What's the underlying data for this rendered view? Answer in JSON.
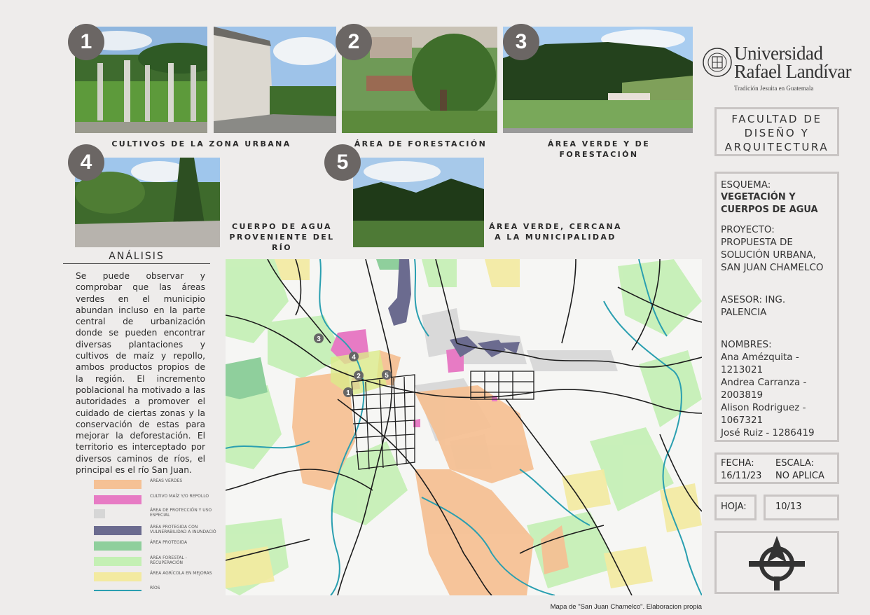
{
  "photos": [
    {
      "badge": "1",
      "caption": "CULTIVOS DE LA ZONA URBANA"
    },
    {
      "badge": "2",
      "caption": "ÁREA DE FORESTACIÓN"
    },
    {
      "badge": "3",
      "caption_line1": "ÁREA VERDE Y DE",
      "caption_line2": "FORESTACIÓN"
    },
    {
      "badge": "4",
      "caption_line1": "CUERPO DE AGUA",
      "caption_line2": "PROVENIENTE DEL RÍO"
    },
    {
      "badge": "5",
      "caption_line1": "ÁREA VERDE, CERCANA",
      "caption_line2": "A LA MUNICIPALIDAD"
    }
  ],
  "analysis": {
    "title": "ANÁLISIS",
    "text": "Se puede observar y comprobar que las áreas verdes en el municipio abundan incluso en la parte central de urbanización donde se pueden encontrar diversas plantaciones y cultivos de maíz y repollo, ambos productos propios de la región. El incremento poblacional ha motivado a las autoridades a promover el cuidado de ciertas zonas y la conservación de estas para mejorar la deforestación. El territorio es interceptado por diversos caminos de ríos, el principal es el río San Juan."
  },
  "legend": [
    {
      "label": "ÁREAS VERDES",
      "color": "#f5c195"
    },
    {
      "label": "CULTIVO MAÍZ Y/O REPOLLO",
      "color": "#e77bc4"
    },
    {
      "label": "ÁREA DE PROTECCIÓN Y USO ESPECIAL",
      "color": "#d6d6d6"
    },
    {
      "label": "ÁREA PROTEGIDA CON VULNERABILIDAD A INUNDACIÓ",
      "color": "#6b6b8f"
    },
    {
      "label": "ÁREA PROTEGIDA",
      "color": "#8fcf9c"
    },
    {
      "label": "ÁREA FORESTAL - RECUPERACIÓN",
      "color": "#c4f0b4"
    },
    {
      "label": "ÁREA AGRÍCOLA EN MEJORAS",
      "color": "#f3eaa0"
    },
    {
      "label": "RÍOS",
      "color": "#2a9fb0"
    }
  ],
  "map": {
    "markers": [
      "1",
      "2",
      "3",
      "4",
      "5"
    ],
    "credit": "Mapa de \"San Juan Chamelco\". Elaboracion propia"
  },
  "logo": {
    "line1": "Universidad",
    "line2": "Rafael Landívar",
    "motto": "Tradición Jesuita en Guatemala"
  },
  "faculty": {
    "line1": "FACULTAD DE",
    "line2": "DISEÑO Y",
    "line3": "ARQUITECTURA"
  },
  "info": {
    "esquema_label": "ESQUEMA:",
    "esquema_value": "VEGETACIÓN Y CUERPOS DE AGUA",
    "proyecto_label": "PROYECTO:",
    "proyecto_value": "PROPUESTA DE SOLUCIÓN URBANA, SAN JUAN CHAMELCO",
    "asesor": "ASESOR: ING. PALENCIA",
    "nombres_label": "NOMBRES:",
    "nombres": [
      "Ana Amézquita - 1213021",
      "Andrea Carranza - 2003819",
      "Alison Rodriguez - 1067321",
      "José Ruiz - 1286419"
    ]
  },
  "fecha": {
    "label": "FECHA:",
    "value": "16/11/23"
  },
  "escala": {
    "label": "ESCALA:",
    "value": "NO APLICA"
  },
  "hoja": {
    "label": "HOJA:",
    "value": "10/13"
  },
  "north_icon": "compass-north-icon"
}
